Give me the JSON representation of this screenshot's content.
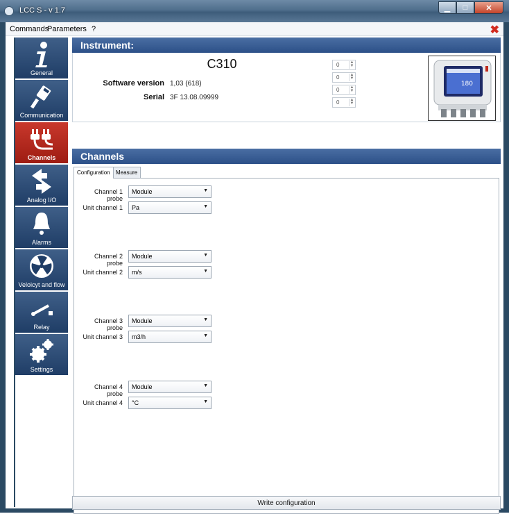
{
  "window": {
    "title": "LCC S - v 1.7",
    "close_symbol": "✖"
  },
  "menu": {
    "items": [
      "Commands",
      "Parameters",
      "?"
    ]
  },
  "sidebar": {
    "items": [
      {
        "label": "General",
        "icon": "info-icon",
        "active": false
      },
      {
        "label": "Communication",
        "icon": "network-cable-icon",
        "active": false
      },
      {
        "label": "Channels",
        "icon": "plug-icon",
        "active": true
      },
      {
        "label": "Analog I/O",
        "icon": "arrows-icon",
        "active": false
      },
      {
        "label": "Alarms",
        "icon": "bell-icon",
        "active": false
      },
      {
        "label": "Veloicyt and flow",
        "icon": "fan-icon",
        "active": false
      },
      {
        "label": "Relay",
        "icon": "switch-icon",
        "active": false
      },
      {
        "label": "Settings",
        "icon": "gears-icon",
        "active": false
      }
    ]
  },
  "instrument": {
    "header": "Instrument:",
    "model": "C310",
    "software_label": "Software version",
    "software_value": "1,03 (618)",
    "serial_label": "Serial",
    "serial_value": "3F 13.08.09999",
    "spinners": [
      "0",
      "0",
      "0",
      "0"
    ],
    "device_display": "180"
  },
  "channels": {
    "header": "Channels",
    "tabs": [
      "Configuration",
      "Measure"
    ],
    "active_tab": "Configuration",
    "rows": [
      {
        "probe_label": "Channel 1 probe",
        "probe_value": "Module",
        "unit_label": "Unit channel 1",
        "unit_value": "Pa"
      },
      {
        "probe_label": "Channel 2 probe",
        "probe_value": "Module",
        "unit_label": "Unit channel 2",
        "unit_value": "m/s"
      },
      {
        "probe_label": "Channel 3 probe",
        "probe_value": "Module",
        "unit_label": "Unit channel 3",
        "unit_value": "m3/h"
      },
      {
        "probe_label": "Channel 4 probe",
        "probe_value": "Module",
        "unit_label": "Unit channel 4",
        "unit_value": "°C"
      }
    ]
  },
  "footer": {
    "write_label": "Write configuration"
  },
  "colors": {
    "section_blue": "#2c5088",
    "nav_blue": "#1f3d66",
    "active_red": "#b0281c",
    "close_red": "#d22a1e"
  }
}
